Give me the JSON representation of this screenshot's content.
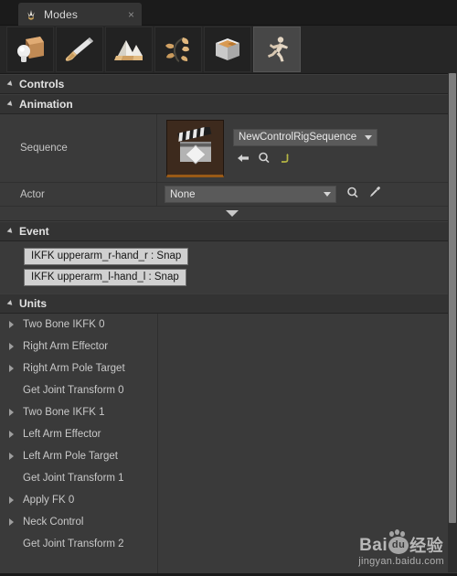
{
  "window": {
    "tab_label": "Modes",
    "tab_icon": "modes-leaf-icon",
    "close_icon": "×"
  },
  "modebar": {
    "buttons": [
      {
        "name": "place-mode",
        "icon": "box-sphere-icon",
        "selected": false
      },
      {
        "name": "paint-mode",
        "icon": "paintbrush-icon",
        "selected": false
      },
      {
        "name": "landscape-mode",
        "icon": "mountain-icon",
        "selected": false
      },
      {
        "name": "foliage-mode",
        "icon": "leaf-sprig-icon",
        "selected": false
      },
      {
        "name": "geometry-editing-mode",
        "icon": "bsp-box-icon",
        "selected": false
      },
      {
        "name": "animation-mode",
        "icon": "running-person-icon",
        "selected": true
      }
    ]
  },
  "sections": {
    "controls": {
      "title": "Controls",
      "expanded": true
    },
    "animation": {
      "title": "Animation",
      "expanded": true
    },
    "event": {
      "title": "Event",
      "expanded": true
    },
    "units": {
      "title": "Units",
      "expanded": true
    }
  },
  "animation": {
    "sequence": {
      "label": "Sequence",
      "thumbnail_icon": "level-sequence-clapperboard-icon",
      "value": "NewControlRigSequence",
      "icons": [
        {
          "name": "browse-back-icon",
          "glyph": "back-arrow"
        },
        {
          "name": "browse-to-asset-icon",
          "glyph": "magnifier"
        },
        {
          "name": "reset-to-default-icon",
          "glyph": "reset-arrow"
        }
      ]
    },
    "actor": {
      "label": "Actor",
      "value": "None",
      "icons": [
        {
          "name": "browse-to-actor-icon",
          "glyph": "magnifier"
        },
        {
          "name": "pick-actor-eyedropper-icon",
          "glyph": "eyedropper"
        }
      ]
    },
    "expander_icon": "expand-down-icon"
  },
  "event": {
    "buttons": [
      {
        "name": "event-ikfk-right-arm-snap",
        "label": "IKFK upperarm_r-hand_r : Snap"
      },
      {
        "name": "event-ikfk-left-arm-snap",
        "label": "IKFK upperarm_l-hand_l : Snap"
      }
    ]
  },
  "units": {
    "rows": [
      {
        "label": "Two Bone IKFK 0",
        "expandable": true
      },
      {
        "label": "Right Arm Effector",
        "expandable": true
      },
      {
        "label": "Right Arm Pole Target",
        "expandable": true
      },
      {
        "label": "Get Joint Transform 0",
        "expandable": false
      },
      {
        "label": "Two Bone IKFK 1",
        "expandable": true
      },
      {
        "label": "Left Arm Effector",
        "expandable": true
      },
      {
        "label": "Left Arm Pole Target",
        "expandable": true
      },
      {
        "label": "Get Joint Transform 1",
        "expandable": false
      },
      {
        "label": "Apply FK 0",
        "expandable": true
      },
      {
        "label": "Neck Control",
        "expandable": true
      },
      {
        "label": "Get Joint Transform 2",
        "expandable": false
      }
    ]
  },
  "watermark": {
    "brand_left": "Bai",
    "brand_paw": "du",
    "brand_cn": "经验",
    "url": "jingyan.baidu.com"
  },
  "colors": {
    "panel_bg": "#3a3a3a",
    "header_bg": "#333333",
    "toolbar_bg": "#262626",
    "tab_bg": "#343434",
    "selected_mode": "#474747",
    "text": "#c9c9c9",
    "event_button_bg": "#d0d0d0",
    "accent_orange": "#9a5a16"
  }
}
